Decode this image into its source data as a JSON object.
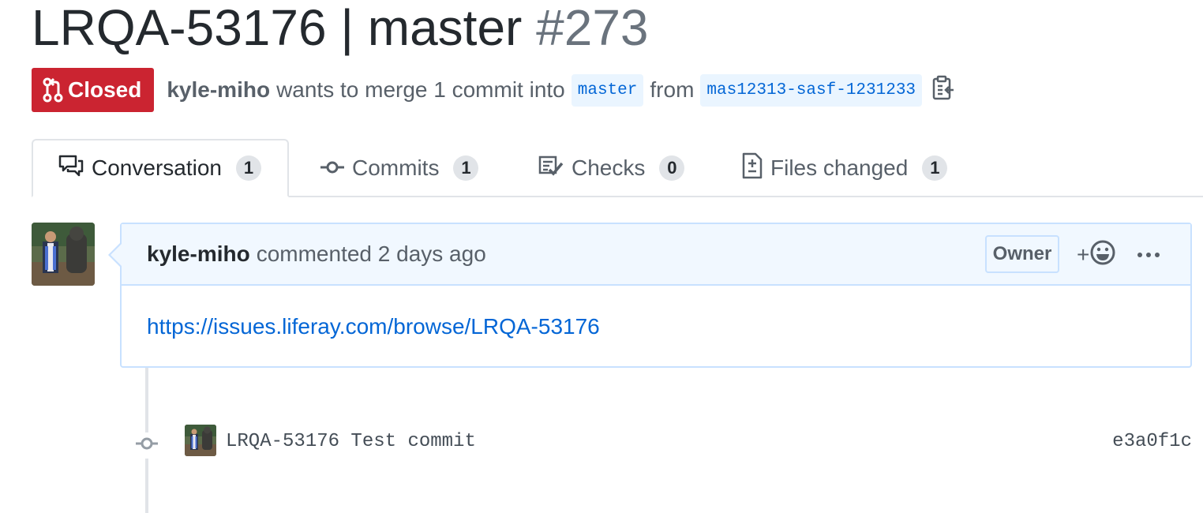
{
  "pr": {
    "title": "LRQA-53176 | master",
    "number": "#273",
    "state": "Closed",
    "author": "kyle-miho",
    "merge_text": "wants to merge 1 commit into",
    "base_branch": "master",
    "from_text": "from",
    "head_branch": "mas12313-sasf-1231233"
  },
  "tabs": [
    {
      "label": "Conversation",
      "count": "1",
      "icon": "comment-discussion-icon"
    },
    {
      "label": "Commits",
      "count": "1",
      "icon": "git-commit-icon"
    },
    {
      "label": "Checks",
      "count": "0",
      "icon": "checklist-icon"
    },
    {
      "label": "Files changed",
      "count": "1",
      "icon": "file-diff-icon"
    }
  ],
  "comment": {
    "author": "kyle-miho",
    "action": "commented 2 days ago",
    "role": "Owner",
    "reaction_label": "+",
    "body_link": "https://issues.liferay.com/browse/LRQA-53176"
  },
  "commit": {
    "message": "LRQA-53176 Test commit",
    "sha": "e3a0f1c"
  },
  "colors": {
    "closed": "#cb2431",
    "link": "#0366d6",
    "comment_header": "#f1f8ff",
    "comment_border": "#c8e1ff"
  }
}
